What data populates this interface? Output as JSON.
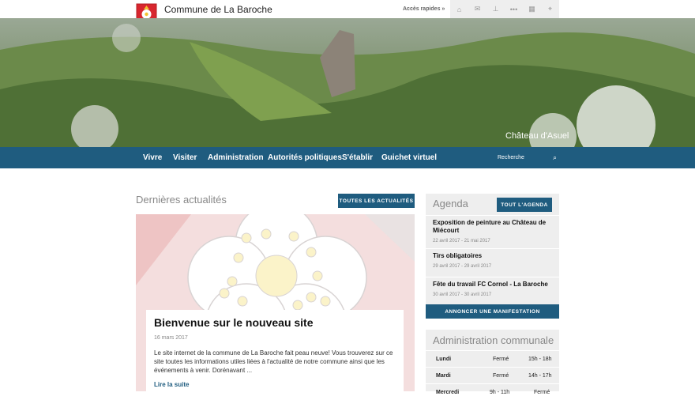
{
  "header": {
    "site_title": "Commune de La Baroche",
    "quick_access": "Accès rapides »",
    "tools": [
      "home-icon",
      "mail-icon",
      "sitemap-icon",
      "more-icon",
      "grid-icon",
      "location-icon"
    ]
  },
  "hero": {
    "caption": "Château d'Asuel"
  },
  "nav": {
    "items": [
      "Vivre",
      "Visiter",
      "Administration",
      "Autorités politiques",
      "S'établir",
      "Guichet virtuel"
    ],
    "search_placeholder": "Recherche"
  },
  "news": {
    "section_title": "Dernières actualités",
    "all_button": "Toutes les actualités",
    "headline": "Bienvenue sur le nouveau site",
    "date": "16 mars 2017",
    "excerpt": "Le site internet de la commune de La Baroche fait peau neuve! Vous trouverez sur ce site toutes les informations utiles liées à l'actualité de notre commune ainsi que les événements à venir. Dorénavant ...",
    "read_more": "Lire la suite"
  },
  "agenda": {
    "title": "Agenda",
    "all_button": "Tout l'agenda",
    "events": [
      {
        "title": "Exposition de peinture au Château de Miécourt",
        "dates": "22 avril 2017 - 21 mai 2017"
      },
      {
        "title": "Tirs obligatoires",
        "dates": "29 avril 2017 - 29 avril 2017"
      },
      {
        "title": "Fête du travail FC Cornol - La Baroche",
        "dates": "30 avril 2017 - 30 avril 2017"
      }
    ],
    "announce_button": "Annoncer une manifestation"
  },
  "admin": {
    "title": "Administration communale",
    "hours": [
      {
        "day": "Lundi",
        "am": "Fermé",
        "pm": "15h - 18h"
      },
      {
        "day": "Mardi",
        "am": "Fermé",
        "pm": "14h - 17h"
      },
      {
        "day": "Mercredi",
        "am": "9h - 11h",
        "pm": "Fermé"
      }
    ]
  },
  "colors": {
    "brand": "#1f5c7f",
    "panel": "#eeeeee"
  }
}
